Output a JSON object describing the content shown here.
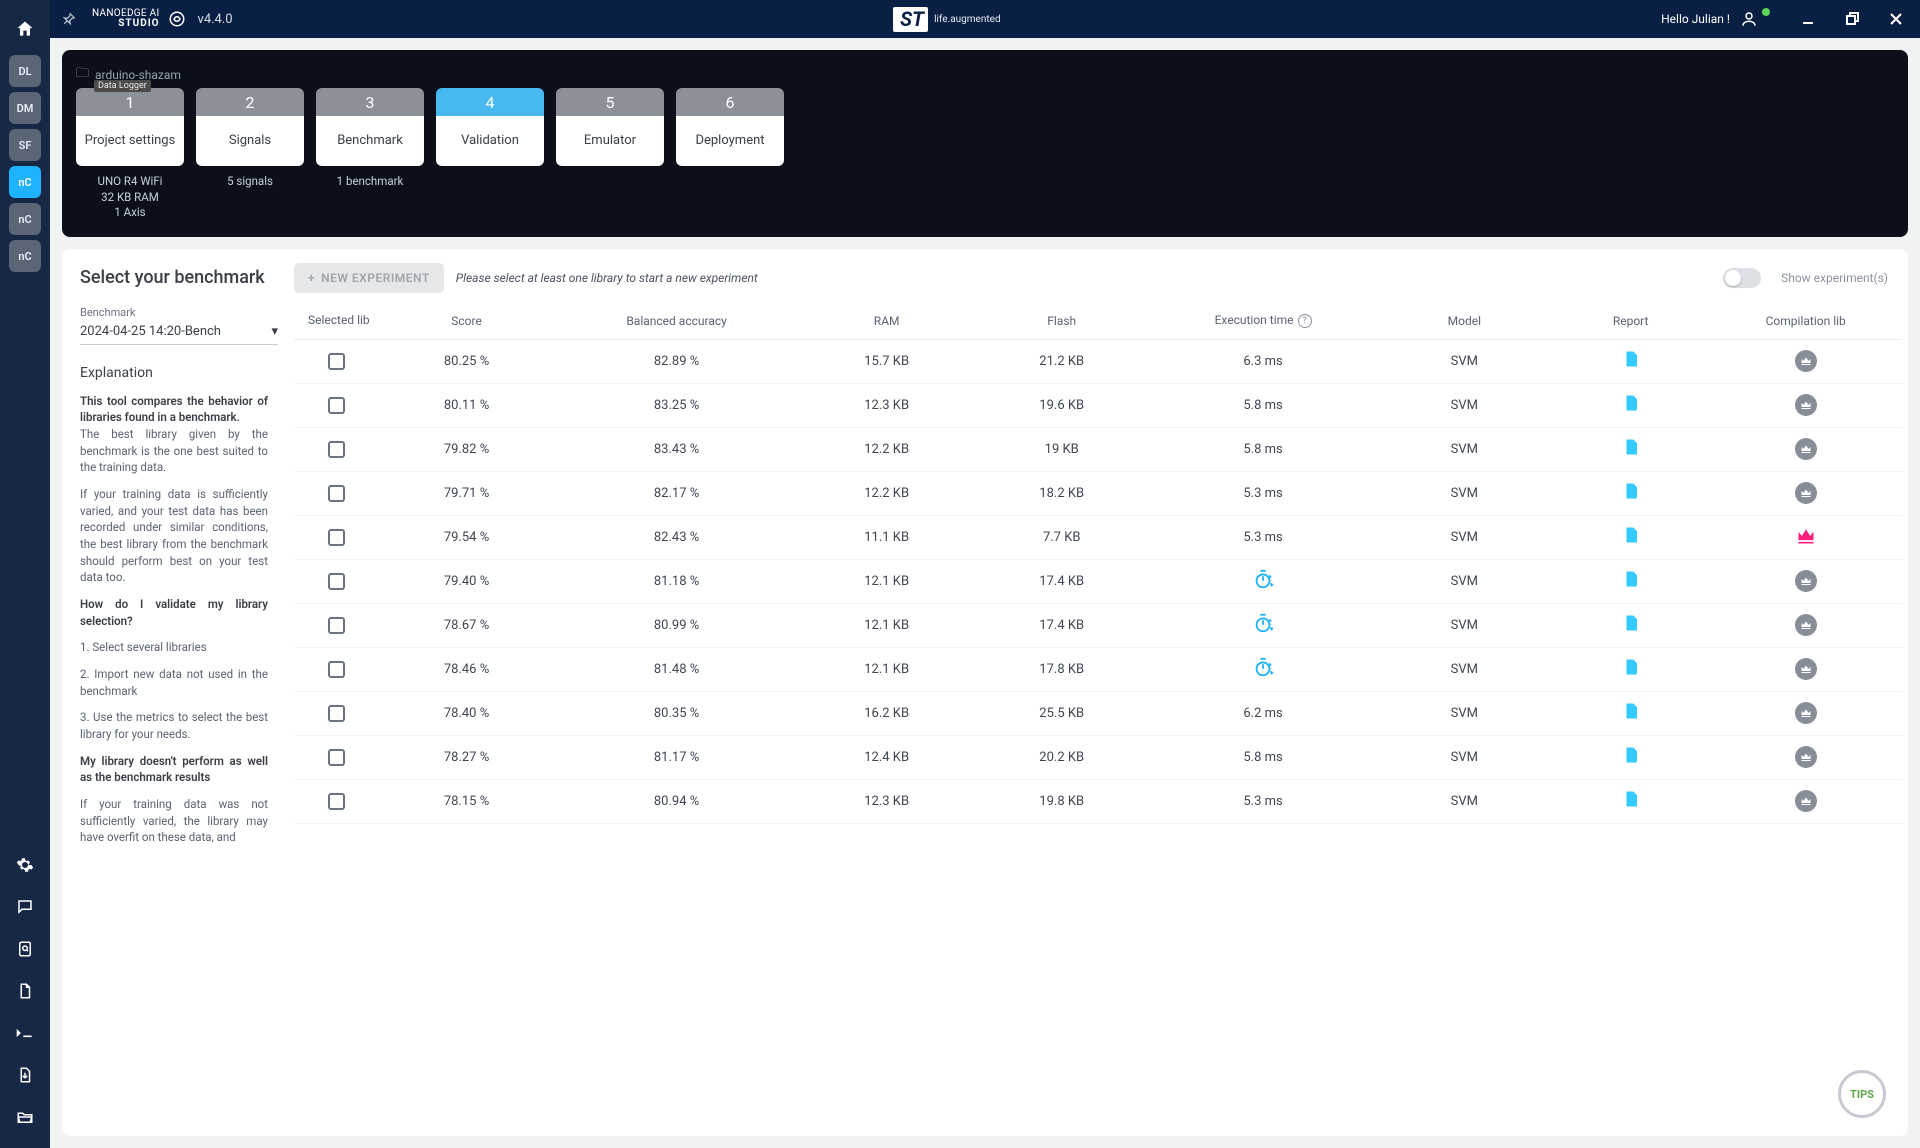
{
  "app": {
    "brand_line1": "NANOEDGE AI",
    "brand_line2": "STUDIO",
    "version": "v4.4.0",
    "center_tag": "life.augmented",
    "hello": "Hello Julian !"
  },
  "left_rail": {
    "top": [
      "DL",
      "DM",
      "SF",
      "nC",
      "nC",
      "nC"
    ]
  },
  "breadcrumb": {
    "project": "arduino-shazam",
    "tooltip": "Data Logger"
  },
  "steps": [
    {
      "num": "1",
      "label": "Project settings",
      "sub": "UNO R4 WiFi\n32 KB RAM\n1 Axis",
      "active": false
    },
    {
      "num": "2",
      "label": "Signals",
      "sub": "5 signals",
      "active": false
    },
    {
      "num": "3",
      "label": "Benchmark",
      "sub": "1 benchmark",
      "active": false
    },
    {
      "num": "4",
      "label": "Validation",
      "sub": "",
      "active": true
    },
    {
      "num": "5",
      "label": "Emulator",
      "sub": "",
      "active": false
    },
    {
      "num": "6",
      "label": "Deployment",
      "sub": "",
      "active": false
    }
  ],
  "select_panel": {
    "title": "Select your benchmark",
    "bench_label": "Benchmark",
    "bench_value": "2024-04-25 14:20-Bench",
    "explain_title": "Explanation",
    "p1_bold": "This tool compares the behavior of libraries found in a benchmark.",
    "p1_rest": "The best library given by the benchmark is the one best suited to the training data.",
    "p2": "If your training data is sufficiently varied, and your test data has been recorded under similar conditions, the best library from the benchmark should perform best on your test data too.",
    "q1": "How do I validate my library selection?",
    "q1_1": "1. Select several libraries",
    "q1_2": "2. Import new data not used in the benchmark",
    "q1_3": "3. Use the metrics to select the best library for your needs.",
    "q2": "My library doesn't perform as well as the benchmark results",
    "q2_text": "If your training data was not sufficiently varied, the library may have overfit on these data, and"
  },
  "toolbar": {
    "new_exp": "NEW EXPERIMENT",
    "hint": "Please select at least one library to start a new experiment",
    "toggle_label": "Show experiment(s)"
  },
  "columns": {
    "selected": "Selected lib",
    "score": "Score",
    "bal_acc": "Balanced accuracy",
    "ram": "RAM",
    "flash": "Flash",
    "exec": "Execution time",
    "model": "Model",
    "report": "Report",
    "comp": "Compilation lib"
  },
  "rows": [
    {
      "score": "80.25 %",
      "bal": "82.89 %",
      "ram": "15.7 KB",
      "flash": "21.2 KB",
      "exec": "6.3 ms",
      "exec_icon": false,
      "model": "SVM",
      "best": false
    },
    {
      "score": "80.11 %",
      "bal": "83.25 %",
      "ram": "12.3 KB",
      "flash": "19.6 KB",
      "exec": "5.8 ms",
      "exec_icon": false,
      "model": "SVM",
      "best": false
    },
    {
      "score": "79.82 %",
      "bal": "83.43 %",
      "ram": "12.2 KB",
      "flash": "19 KB",
      "exec": "5.8 ms",
      "exec_icon": false,
      "model": "SVM",
      "best": false
    },
    {
      "score": "79.71 %",
      "bal": "82.17 %",
      "ram": "12.2 KB",
      "flash": "18.2 KB",
      "exec": "5.3 ms",
      "exec_icon": false,
      "model": "SVM",
      "best": false
    },
    {
      "score": "79.54 %",
      "bal": "82.43 %",
      "ram": "11.1 KB",
      "flash": "7.7 KB",
      "exec": "5.3 ms",
      "exec_icon": false,
      "model": "SVM",
      "best": true
    },
    {
      "score": "79.40 %",
      "bal": "81.18 %",
      "ram": "12.1 KB",
      "flash": "17.4 KB",
      "exec": "",
      "exec_icon": true,
      "model": "SVM",
      "best": false
    },
    {
      "score": "78.67 %",
      "bal": "80.99 %",
      "ram": "12.1 KB",
      "flash": "17.4 KB",
      "exec": "",
      "exec_icon": true,
      "model": "SVM",
      "best": false
    },
    {
      "score": "78.46 %",
      "bal": "81.48 %",
      "ram": "12.1 KB",
      "flash": "17.8 KB",
      "exec": "",
      "exec_icon": true,
      "model": "SVM",
      "best": false
    },
    {
      "score": "78.40 %",
      "bal": "80.35 %",
      "ram": "16.2 KB",
      "flash": "25.5 KB",
      "exec": "6.2 ms",
      "exec_icon": false,
      "model": "SVM",
      "best": false
    },
    {
      "score": "78.27 %",
      "bal": "81.17 %",
      "ram": "12.4 KB",
      "flash": "20.2 KB",
      "exec": "5.8 ms",
      "exec_icon": false,
      "model": "SVM",
      "best": false
    },
    {
      "score": "78.15 %",
      "bal": "80.94 %",
      "ram": "12.3 KB",
      "flash": "19.8 KB",
      "exec": "5.3 ms",
      "exec_icon": false,
      "model": "SVM",
      "best": false
    }
  ],
  "tips": "TIPS"
}
